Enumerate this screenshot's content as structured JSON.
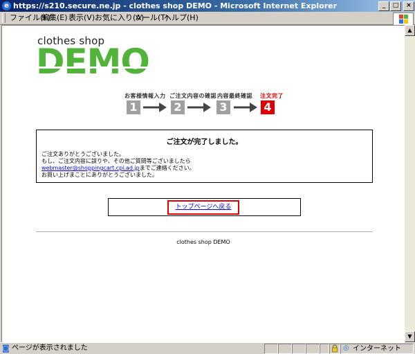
{
  "window": {
    "title": "https://s210.secure.ne.jp - clothes shop DEMO - Microsoft Internet Explorer",
    "buttons": [
      "_",
      "□",
      "×"
    ]
  },
  "menubar": {
    "items": [
      "ファイル(F)",
      "編集(E)",
      "表示(V)",
      "お気に入り(A)",
      "ツール(T)",
      "ヘルプ(H)"
    ]
  },
  "logo": {
    "small": "clothes shop",
    "big": "DEMO",
    "color": "#52b33b"
  },
  "steps": [
    {
      "label": "お客様情報入力",
      "number": "1"
    },
    {
      "label": "ご注文内容の確認",
      "number": "2"
    },
    {
      "label": "内容最終確認",
      "number": "3"
    },
    {
      "label": "注文完了",
      "number": "4"
    }
  ],
  "message": {
    "title": "ご注文が完了しました。",
    "line1": "ご注文ありがとうございました。",
    "line2": "もし、ご注文内容に誤りや、その他ご質問等ございましたら",
    "email": "webmaster@shoppingcart.cpi.ad.jp",
    "line3_suffix": "までご連絡ください。",
    "line4": "お買い上げまことにありがとうございました。"
  },
  "top_link": "トップページへ戻る",
  "footer": "clothes shop DEMO",
  "status": {
    "text": "ページが表示されました",
    "zone": "インターネット"
  },
  "colors": {
    "accent_red": "#e10000",
    "step_gray": "#a0a0a0",
    "link": "#0000ee"
  }
}
